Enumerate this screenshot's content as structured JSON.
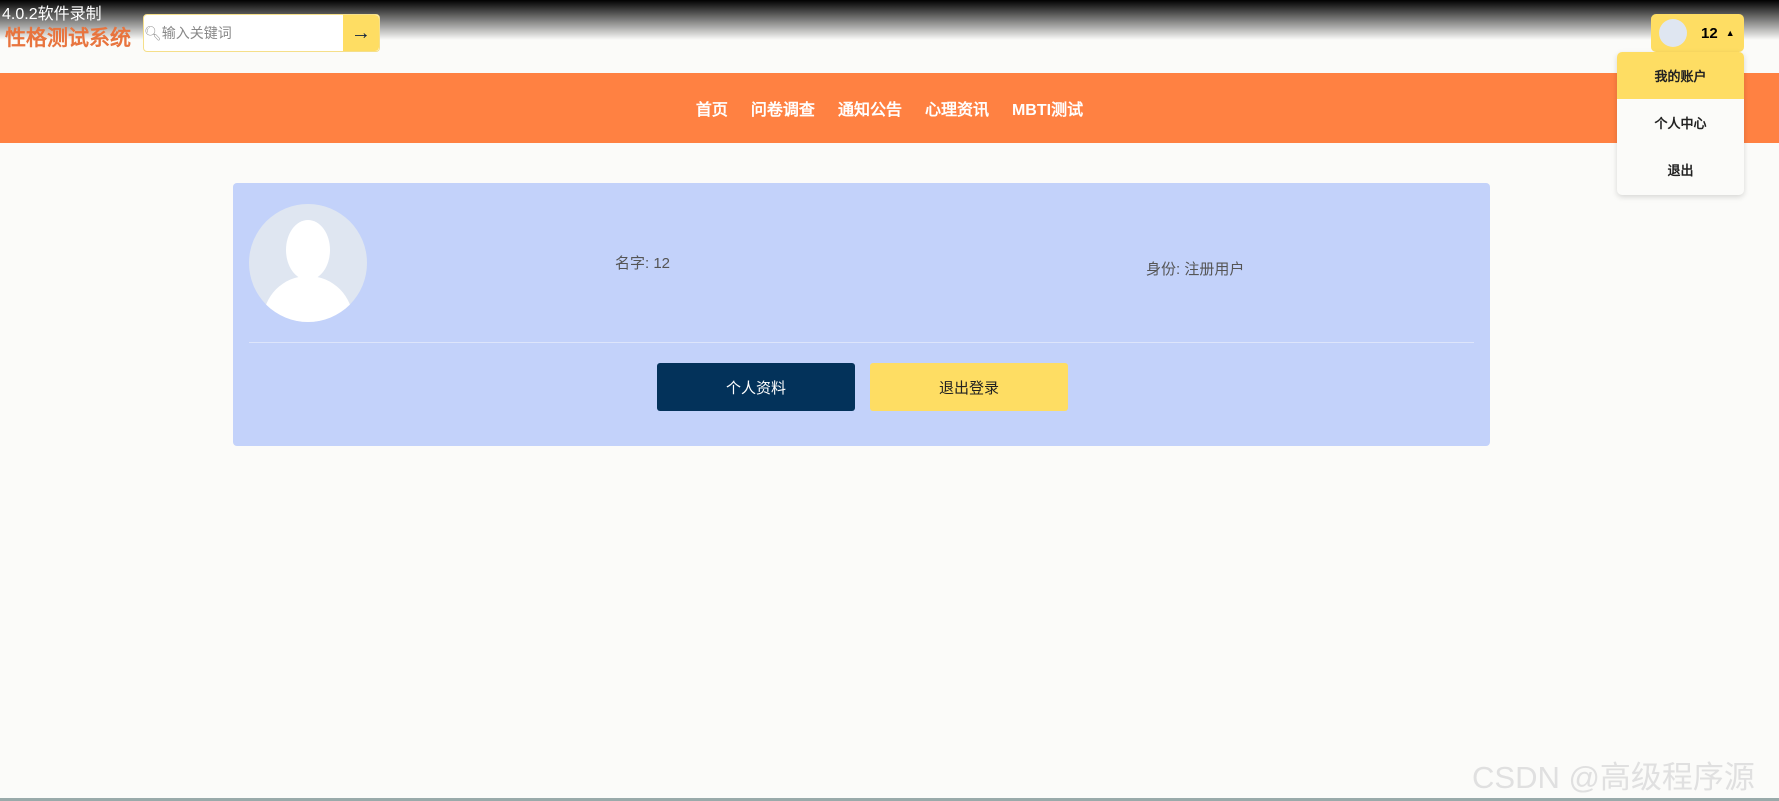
{
  "overlay": {
    "recorder_text": "4.0.2软件录制",
    "watermark": "CSDN @高级程序源"
  },
  "header": {
    "logo": "性格测试系统",
    "search_placeholder": "输入关键词",
    "search_value": "",
    "user_name": "12"
  },
  "nav": {
    "items": [
      "首页",
      "问卷调查",
      "通知公告",
      "心理资讯",
      "MBTI测试"
    ]
  },
  "dropdown": {
    "items": [
      "我的账户",
      "个人中心",
      "退出"
    ]
  },
  "profile": {
    "name_label": "名字: 12",
    "identity_label": "身份: 注册用户",
    "profile_button": "个人资料",
    "logout_button": "退出登录"
  }
}
